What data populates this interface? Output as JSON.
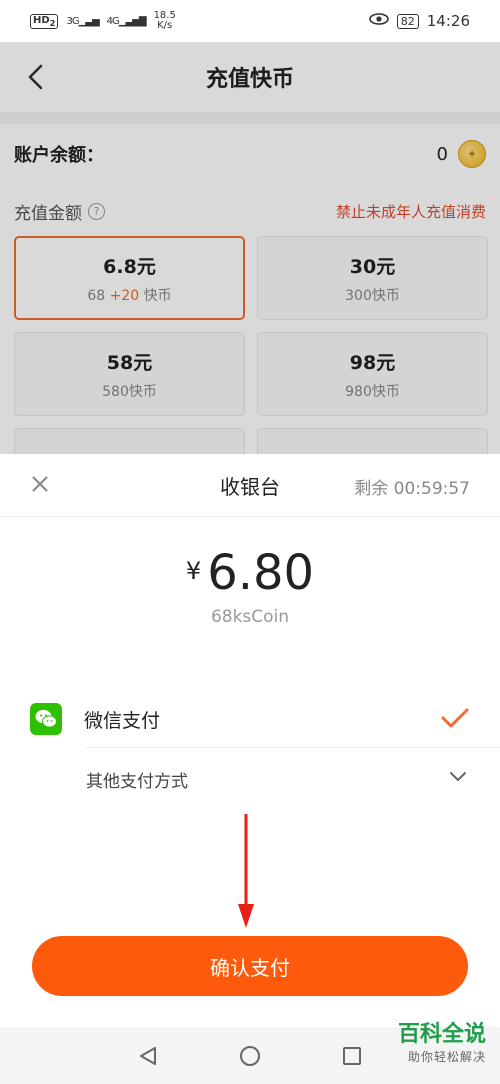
{
  "status_bar": {
    "hd": "HD",
    "hd_sub": "2",
    "signal1": "3G",
    "signal2": "4G",
    "speed_value": "18.5",
    "speed_unit": "K/s",
    "battery": "82",
    "time": "14:26"
  },
  "header": {
    "title": "充值快币"
  },
  "balance": {
    "label": "账户余额：",
    "value": "0"
  },
  "amount": {
    "title": "充值金额",
    "warning": "禁止未成年人充值消费",
    "options": [
      {
        "price": "6.8元",
        "coins": "68",
        "bonus": "+20",
        "unit": "快币",
        "selected": true
      },
      {
        "price": "30元",
        "coins": "300快币"
      },
      {
        "price": "58元",
        "coins": "580快币"
      },
      {
        "price": "98元",
        "coins": "980快币"
      }
    ]
  },
  "cashier": {
    "title": "收银台",
    "timer": "剩余 00:59:57",
    "currency_symbol": "¥",
    "amount": "6.80",
    "subtitle": "68ksCoin",
    "payment_method": "微信支付",
    "other_methods": "其他支付方式",
    "confirm": "确认支付"
  },
  "watermark": {
    "title": "百科全说",
    "subtitle": "助你轻松解决"
  },
  "colors": {
    "accent": "#fe5a0b",
    "selected_border": "#f26a2d",
    "warning": "#e64a2e",
    "wechat": "#2dc100",
    "arrow": "#e8201a"
  }
}
